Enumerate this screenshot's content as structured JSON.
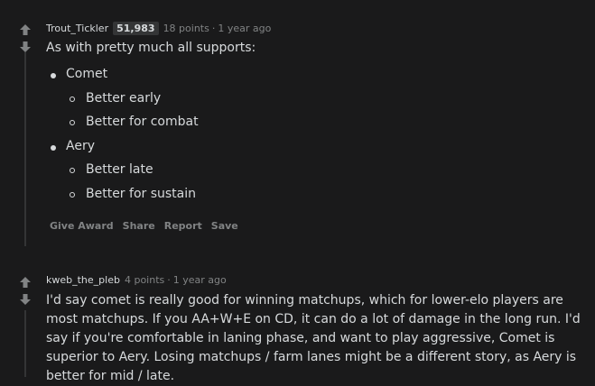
{
  "comments": [
    {
      "author": "Trout_Tickler",
      "flair": "51,983",
      "points": "18 points",
      "separator": "·",
      "time": "1 year ago",
      "intro": "As with pretty much all supports:",
      "list": [
        {
          "label": "Comet",
          "sub": [
            "Better early",
            "Better for combat"
          ]
        },
        {
          "label": "Aery",
          "sub": [
            "Better late",
            "Better for sustain"
          ]
        }
      ],
      "actions": [
        "Give Award",
        "Share",
        "Report",
        "Save"
      ]
    },
    {
      "author": "kweb_the_pleb",
      "points": "4 points",
      "separator": "·",
      "time": "1 year ago",
      "body": "I'd say comet is really good for winning matchups, which for lower-elo players are most matchups. If you AA+W+E on CD, it can do a lot of damage in the long run. I'd say if you're comfortable in laning phase, and want to play aggressive, Comet is superior to Aery. Losing matchups / farm lanes might be a different story, as Aery is better for mid / late."
    }
  ],
  "colors": {
    "background": "#1a1a1b",
    "text": "#d7dadc",
    "muted": "#818384",
    "thread_line": "#343536"
  },
  "icons": {
    "upvote": "upvote-arrow-icon",
    "downvote": "downvote-arrow-icon"
  }
}
